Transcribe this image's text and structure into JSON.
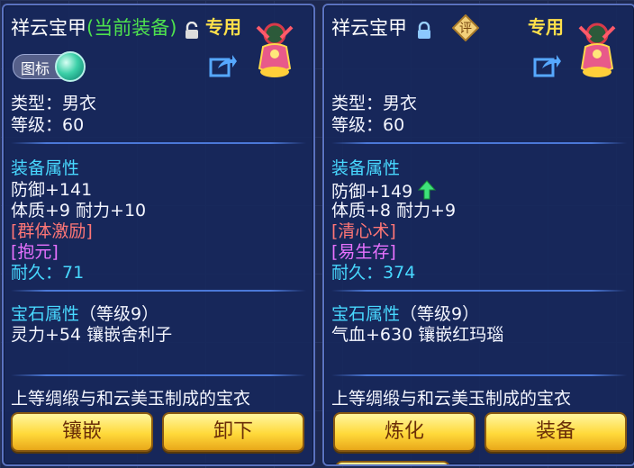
{
  "left": {
    "title": "祥云宝甲",
    "equipped": "(当前装备)",
    "special": "专用",
    "badge": "图标",
    "type": "类型：男衣",
    "level": "等级：60",
    "attr_header": "装备属性",
    "defense": "防御+141",
    "stats": "体质+9 耐力+10",
    "skill1": "[群体激励]",
    "skill2": "[抱元]",
    "durability_label": "耐久：",
    "durability": "71",
    "gem_header": "宝石属性",
    "gem_level": "（等级9）",
    "gem_stats": "灵力+54 镶嵌舍利子",
    "description": "上等绸缎与和云美玉制成的宝衣",
    "btn1": "镶嵌",
    "btn2": "卸下"
  },
  "right": {
    "title": "祥云宝甲",
    "rate_icon": "评",
    "special": "专用",
    "type": "类型：男衣",
    "level": "等级：60",
    "attr_header": "装备属性",
    "defense": "防御+149",
    "stats": "体质+8 耐力+9",
    "skill1": "[清心术]",
    "skill2": "[易生存]",
    "durability_label": "耐久：",
    "durability": "374",
    "gem_header": "宝石属性",
    "gem_level": "（等级9）",
    "gem_stats": "气血+630 镶嵌红玛瑙",
    "description": "上等绸缎与和云美玉制成的宝衣",
    "btn1": "炼化",
    "btn2": "装备"
  },
  "icons": {
    "unlocked": "lock-open-icon",
    "locked": "lock-icon",
    "share": "share-icon",
    "upgrade": "arrow-up-icon",
    "armor": "armor-figure-icon"
  }
}
